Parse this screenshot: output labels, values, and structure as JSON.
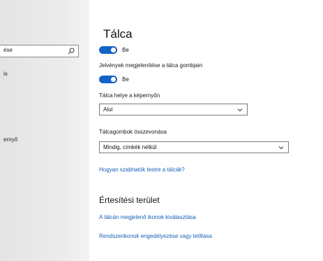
{
  "nav": {
    "search_value": "ése",
    "items": [
      "is",
      "ernyő"
    ]
  },
  "main": {
    "title": "Tálca",
    "toggle1_label": "Be",
    "badges_label": "Jelvények megjelenítése a tálca gombjain",
    "toggle2_label": "Be",
    "position_label": "Tálca helye a képernyőn",
    "position_value": "Alul",
    "combine_label": "Tálcagombok összevonása",
    "combine_value": "Mindig, címkék nélkül",
    "customize_link": "Hogyan szabhatók testre a tálcák?",
    "notification_title": "Értesítési terület",
    "notif_link1": "A tálcán megjelenő ikonok kiválasztása",
    "notif_link2": "Rendszerikonok engedélyezése vagy letiltása"
  },
  "colors": {
    "accent": "#1464c8",
    "link": "#1560b5"
  }
}
